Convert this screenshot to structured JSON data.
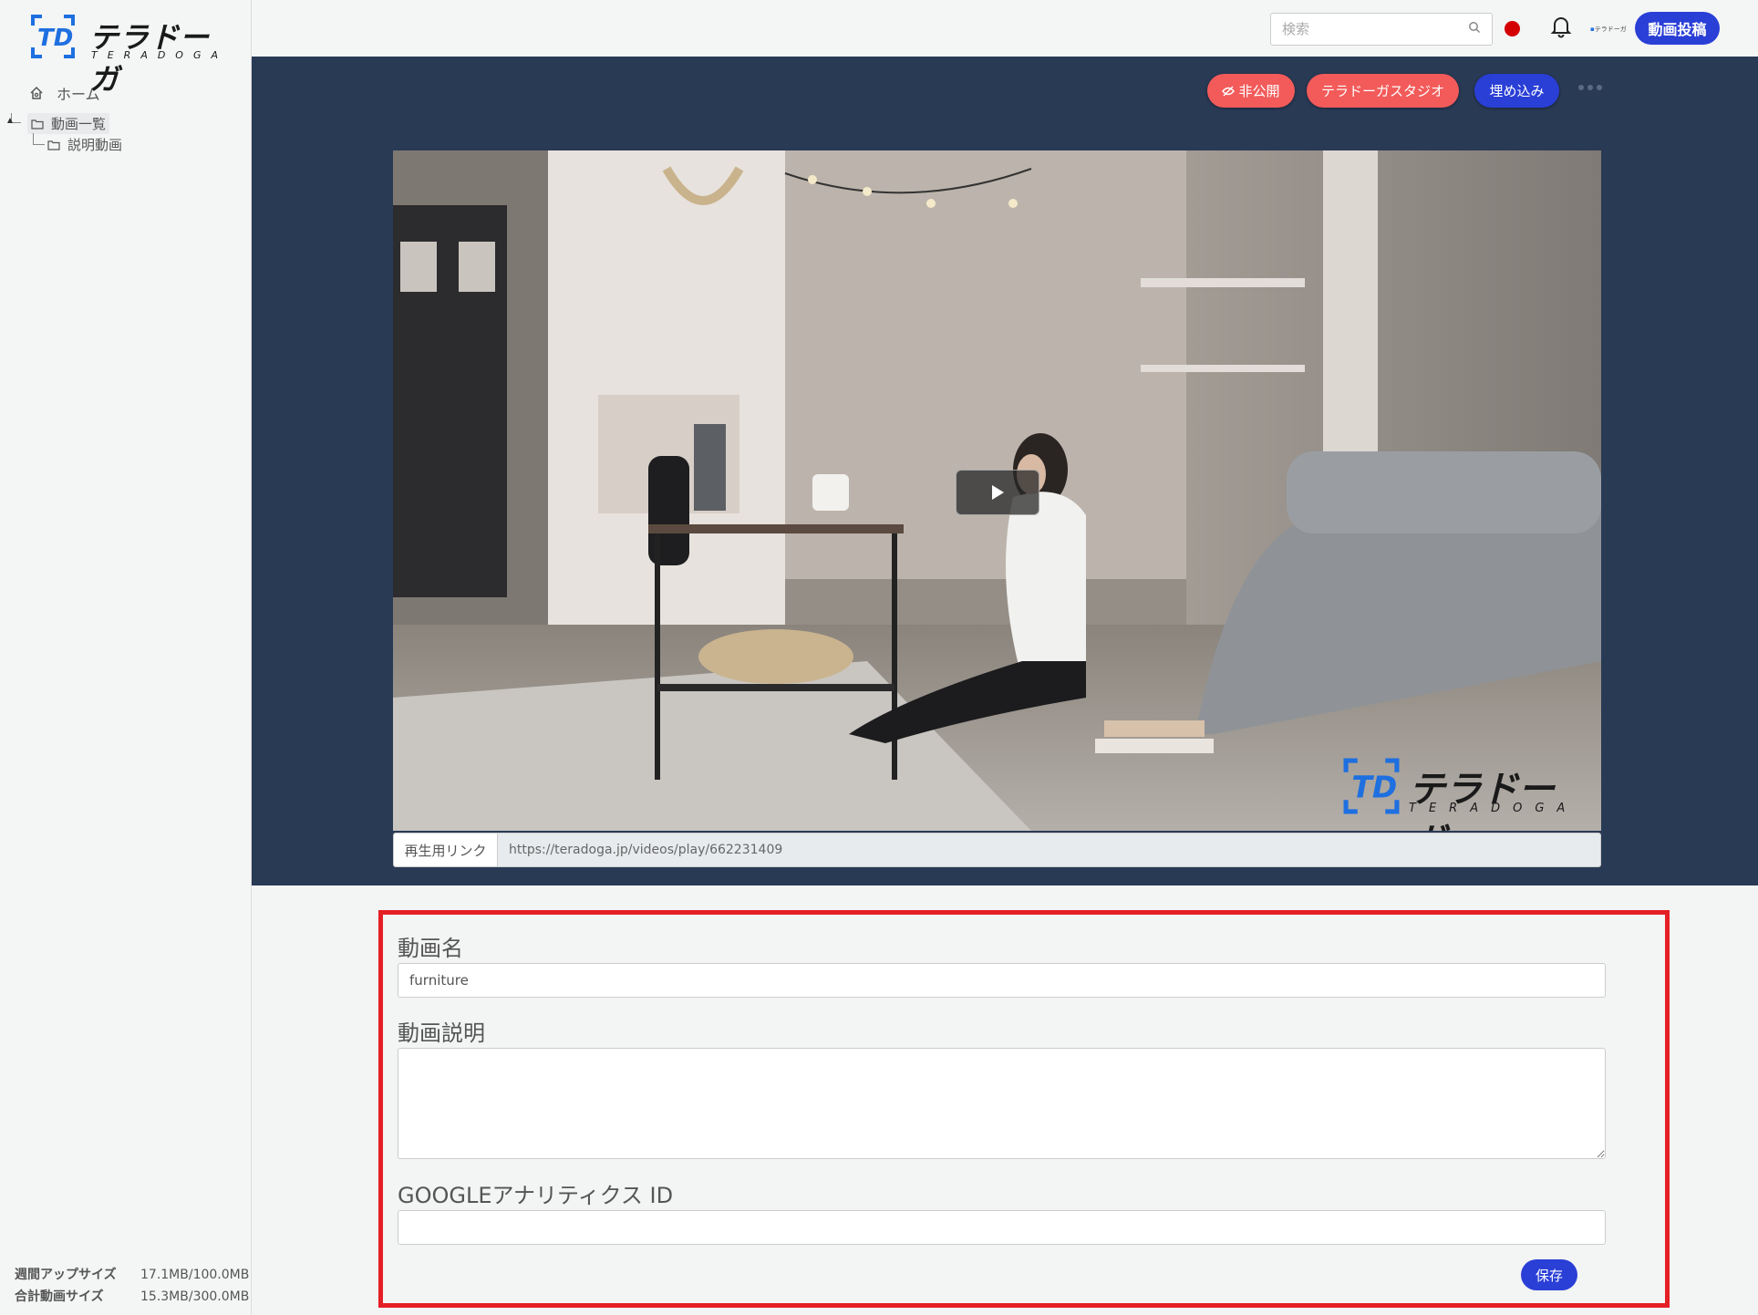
{
  "brand": {
    "name": "テラドーガ",
    "sub": "TERADOGA",
    "mini_logo": "テラドーガ"
  },
  "sidebar": {
    "home": "ホーム",
    "folders": [
      {
        "label": "動画一覧"
      },
      {
        "label": "説明動画"
      }
    ],
    "storage": [
      {
        "label": "週間アップサイズ",
        "value": "17.1MB/100.0MB"
      },
      {
        "label": "合計動画サイズ",
        "value": "15.3MB/300.0MB"
      }
    ]
  },
  "topbar": {
    "search_placeholder": "検索",
    "upload_label": "動画投稿"
  },
  "hero": {
    "private_label": "非公開",
    "studio_label": "テラドーガスタジオ",
    "embed_label": "埋め込み",
    "playback_link_label": "再生用リンク",
    "playback_link": "https://teradoga.jp/videos/play/662231409",
    "watermark": "テラドーガ",
    "watermark_sub": "TERADOGA"
  },
  "form": {
    "name_label": "動画名",
    "name_value": "furniture",
    "desc_label": "動画説明",
    "desc_value": "",
    "ga_label": "GOOGLEアナリティクス ID",
    "ga_value": "",
    "save_label": "保存"
  },
  "colors": {
    "hero_bg": "#293a55",
    "accent_blue": "#2a3fd6",
    "accent_red": "#f25b5a",
    "highlight_border": "#e41f25",
    "record_dot": "#d40000"
  },
  "icons": [
    "home-icon",
    "folder-icon",
    "search-icon",
    "bell-icon",
    "eye-slash-icon",
    "more-icon",
    "play-icon"
  ]
}
